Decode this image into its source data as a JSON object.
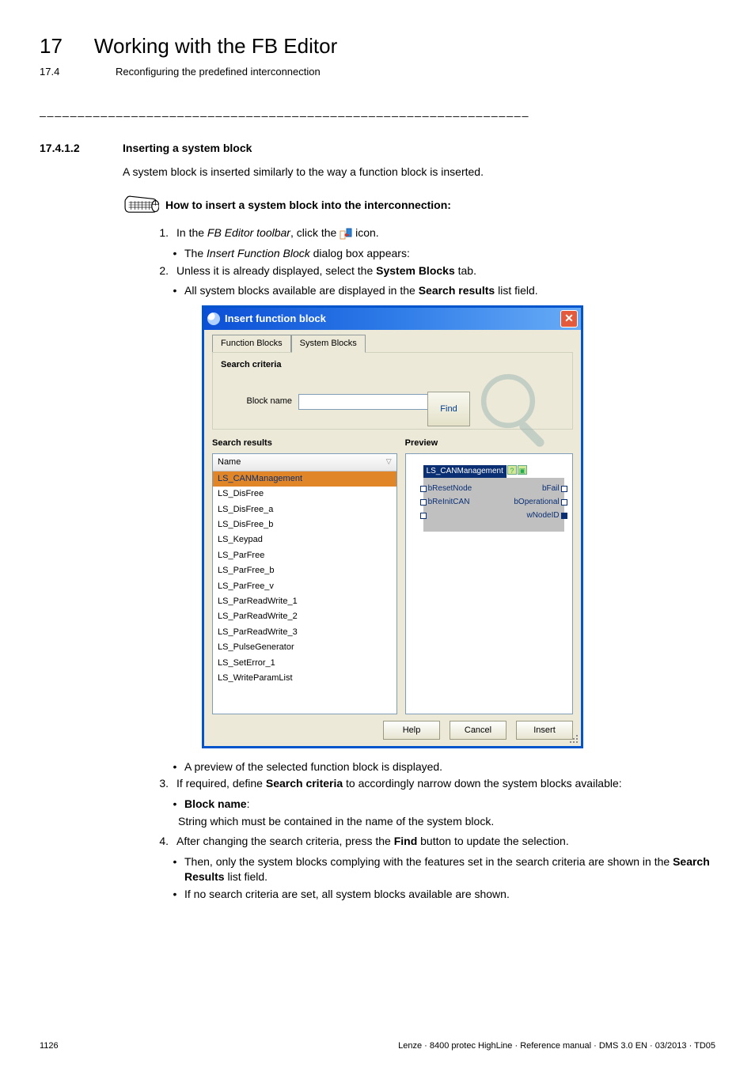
{
  "header": {
    "chapter_num": "17",
    "chapter_title": "Working with the FB Editor",
    "sub_num": "17.4",
    "sub_title": "Reconfiguring the predefined interconnection"
  },
  "section": {
    "num": "17.4.1.2",
    "title": "Inserting a system block"
  },
  "intro": "A system block is inserted similarly to the way a function block is inserted.",
  "instruction_heading": "How to insert a system block into the interconnection:",
  "steps": {
    "1": {
      "num": "1.",
      "pre": "In the ",
      "i1": "FB Editor toolbar",
      "mid": ", click the ",
      "post": " icon.",
      "sub": {
        "pre": "The ",
        "i1": "Insert Function Block",
        "post": " dialog box appears:"
      }
    },
    "2": {
      "num": "2.",
      "pre": "Unless it is already displayed, select the ",
      "b1": "System Blocks",
      "post": " tab.",
      "sub": {
        "pre": "All system blocks available are displayed in the ",
        "b1": "Search results",
        "post": " list field."
      }
    },
    "after_dialog_bullet": "A preview of the selected function block is displayed.",
    "3": {
      "num": "3.",
      "pre": "If required, define ",
      "b1": "Search criteria",
      "post": " to accordingly narrow down the system blocks available:",
      "sub_bold": "Block name",
      "sub_colon": ":",
      "sub_text": "String which must be contained in the name of the system block."
    },
    "4": {
      "num": "4.",
      "pre": "After changing the search criteria, press the ",
      "b1": "Find",
      "post": " button to update the selection.",
      "sub1": {
        "pre": "Then, only the system blocks complying with the features set in the search criteria are shown in the ",
        "b1": "Search Results",
        "post": " list field."
      },
      "sub2": "If no search criteria are set, all system blocks available are shown."
    }
  },
  "dialog": {
    "title": "Insert function block",
    "tabs": {
      "fb": "Function Blocks",
      "sb": "System Blocks"
    },
    "search_criteria": {
      "title": "Search criteria",
      "label": "Block name",
      "find": "Find"
    },
    "search_results": {
      "title": "Search results",
      "header": "Name",
      "rows": [
        "LS_CANManagement",
        "LS_DisFree",
        "LS_DisFree_a",
        "LS_DisFree_b",
        "LS_Keypad",
        "LS_ParFree",
        "LS_ParFree_b",
        "LS_ParFree_v",
        "LS_ParReadWrite_1",
        "LS_ParReadWrite_2",
        "LS_ParReadWrite_3",
        "LS_PulseGenerator",
        "LS_SetError_1",
        "LS_WriteParamList"
      ]
    },
    "preview": {
      "title": "Preview",
      "block_title": "LS_CANManagement",
      "io": {
        "l1": "bResetNode",
        "r1": "bFail",
        "l2": "bReInitCAN",
        "r2": "bOperational",
        "r3": "wNodeID"
      }
    },
    "buttons": {
      "help": "Help",
      "cancel": "Cancel",
      "insert": "Insert"
    }
  },
  "footer": {
    "page": "1126",
    "right": "Lenze · 8400 protec HighLine · Reference manual · DMS 3.0 EN · 03/2013 · TD05"
  }
}
